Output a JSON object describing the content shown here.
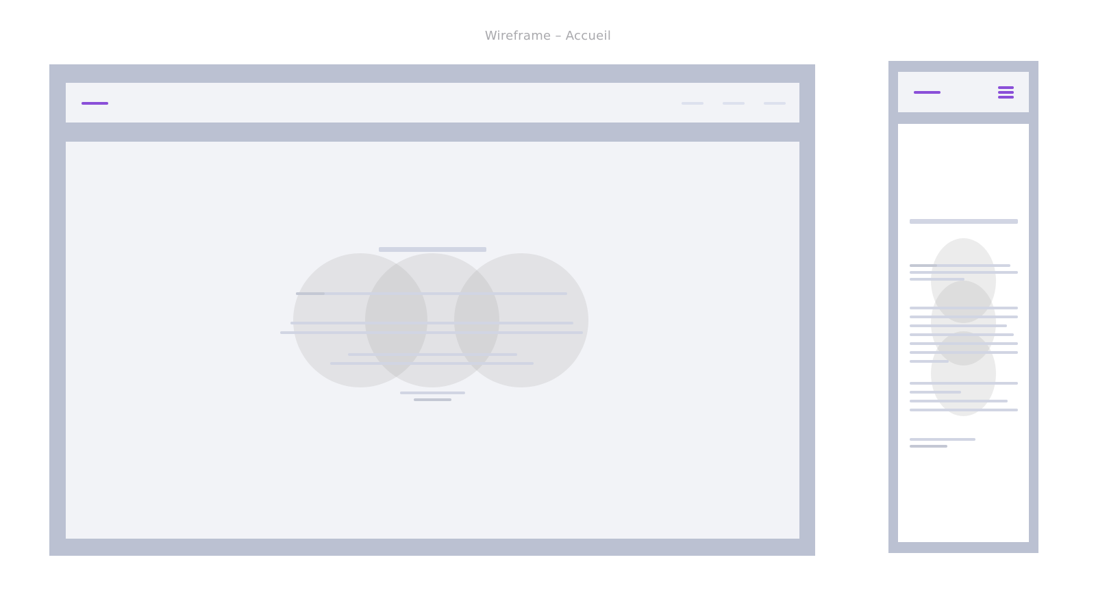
{
  "page": {
    "title": "Wireframe – Accueil"
  },
  "colors": {
    "frame": "#bbc1d2",
    "panel": "#f2f3f7",
    "accent": "#8a4fd8",
    "placeholder_bar": "#d1d5e3",
    "circle": "#dcdcdc"
  },
  "desktop": {
    "nav_links": 3,
    "hero_circles": 3
  },
  "mobile": {
    "menu_icon": "hamburger-icon",
    "circles": 3
  }
}
